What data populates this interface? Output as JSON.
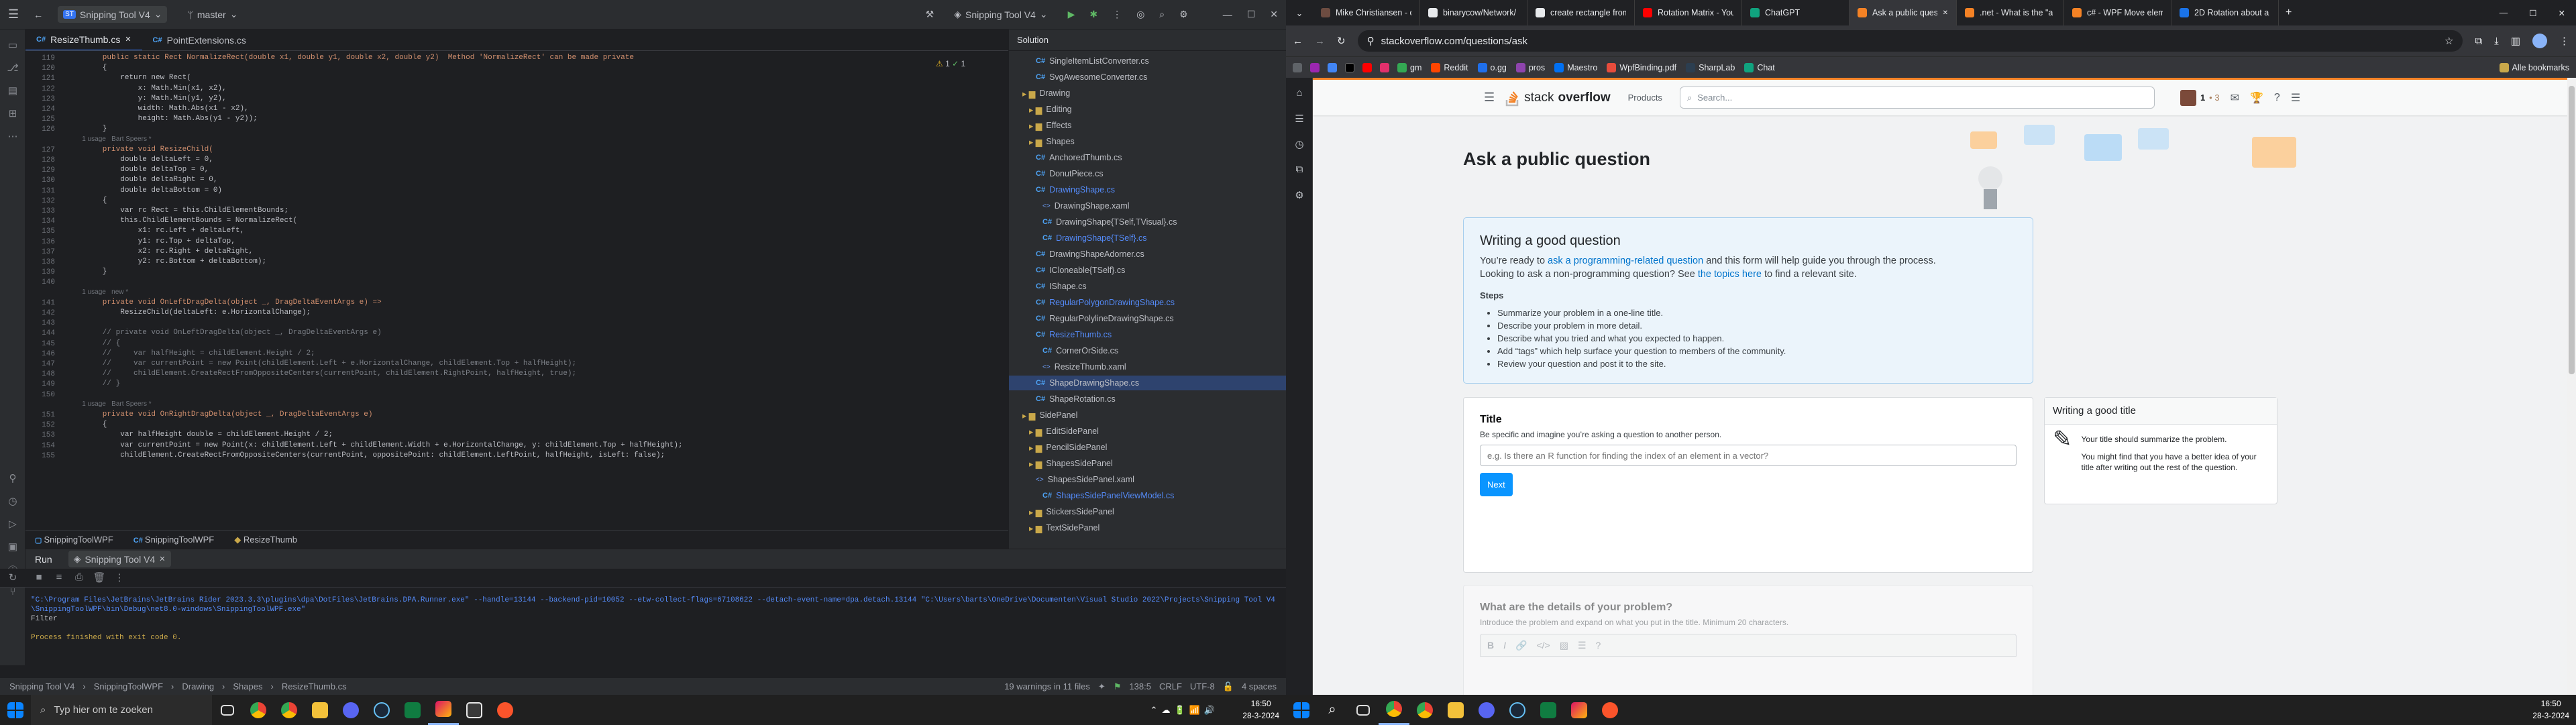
{
  "ide": {
    "project": "Snipping Tool V4",
    "branch": "master",
    "run_config": "Snipping Tool V4",
    "tabs": [
      {
        "label": "ResizeThumb.cs",
        "active": true
      },
      {
        "label": "PointExtensions.cs",
        "active": false
      }
    ],
    "inspections": {
      "warnings": "1",
      "checks": "1"
    },
    "code_lines": [
      {
        "n": "119",
        "text": "        public static Rect NormalizeRect(double x1, double y1, double x2, double y2)  Method 'NormalizeRect' can be made private",
        "cls": "kw"
      },
      {
        "n": "120",
        "text": "        {",
        "cls": ""
      },
      {
        "n": "121",
        "text": "            return new Rect(",
        "cls": ""
      },
      {
        "n": "122",
        "text": "                x: Math.Min(x1, x2),",
        "cls": ""
      },
      {
        "n": "123",
        "text": "                y: Math.Min(y1, y2),",
        "cls": ""
      },
      {
        "n": "124",
        "text": "                width: Math.Abs(x1 - x2),",
        "cls": ""
      },
      {
        "n": "125",
        "text": "                height: Math.Abs(y1 - y2));",
        "cls": ""
      },
      {
        "n": "126",
        "text": "        }",
        "cls": ""
      },
      {
        "n": "",
        "text": "        1 usage   Bart Speers *",
        "cls": "hint"
      },
      {
        "n": "127",
        "text": "        private void ResizeChild(",
        "cls": "kw"
      },
      {
        "n": "128",
        "text": "            double deltaLeft = 0,",
        "cls": ""
      },
      {
        "n": "129",
        "text": "            double deltaTop = 0,",
        "cls": ""
      },
      {
        "n": "130",
        "text": "            double deltaRight = 0,",
        "cls": ""
      },
      {
        "n": "131",
        "text": "            double deltaBottom = 0)",
        "cls": ""
      },
      {
        "n": "132",
        "text": "        {",
        "cls": ""
      },
      {
        "n": "133",
        "text": "            var rc Rect = this.ChildElementBounds;",
        "cls": ""
      },
      {
        "n": "134",
        "text": "            this.ChildElementBounds = NormalizeRect(",
        "cls": ""
      },
      {
        "n": "135",
        "text": "                x1: rc.Left + deltaLeft,",
        "cls": ""
      },
      {
        "n": "136",
        "text": "                y1: rc.Top + deltaTop,",
        "cls": ""
      },
      {
        "n": "137",
        "text": "                x2: rc.Right + deltaRight,",
        "cls": ""
      },
      {
        "n": "138",
        "text": "                y2: rc.Bottom + deltaBottom);",
        "cls": ""
      },
      {
        "n": "139",
        "text": "        }",
        "cls": ""
      },
      {
        "n": "140",
        "text": "",
        "cls": "cur"
      },
      {
        "n": "",
        "text": "        1 usage   new *",
        "cls": "hint"
      },
      {
        "n": "141",
        "text": "        private void OnLeftDragDelta(object _, DragDeltaEventArgs e) =>",
        "cls": "kw"
      },
      {
        "n": "142",
        "text": "            ResizeChild(deltaLeft: e.HorizontalChange);",
        "cls": ""
      },
      {
        "n": "143",
        "text": "",
        "cls": ""
      },
      {
        "n": "144",
        "text": "        // private void OnLeftDragDelta(object _, DragDeltaEventArgs e)",
        "cls": "cm"
      },
      {
        "n": "145",
        "text": "        // {",
        "cls": "cm"
      },
      {
        "n": "146",
        "text": "        //     var halfHeight = childElement.Height / 2;",
        "cls": "cm"
      },
      {
        "n": "147",
        "text": "        //     var currentPoint = new Point(childElement.Left + e.HorizontalChange, childElement.Top + halfHeight);",
        "cls": "cm"
      },
      {
        "n": "148",
        "text": "        //     childElement.CreateRectFromOppositeCenters(currentPoint, childElement.RightPoint, halfHeight, true);",
        "cls": "cm"
      },
      {
        "n": "149",
        "text": "        // }",
        "cls": "cm"
      },
      {
        "n": "150",
        "text": "",
        "cls": ""
      },
      {
        "n": "",
        "text": "        1 usage   Bart Speers *",
        "cls": "hint"
      },
      {
        "n": "151",
        "text": "        private void OnRightDragDelta(object _, DragDeltaEventArgs e)",
        "cls": "kw"
      },
      {
        "n": "152",
        "text": "        {",
        "cls": ""
      },
      {
        "n": "153",
        "text": "            var halfHeight double = childElement.Height / 2;",
        "cls": ""
      },
      {
        "n": "154",
        "text": "            var currentPoint = new Point(x: childElement.Left + childElement.Width + e.HorizontalChange, y: childElement.Top + halfHeight);",
        "cls": ""
      },
      {
        "n": "155",
        "text": "            childElement.CreateRectFromOppositeCenters(currentPoint, oppositePoint: childElement.LeftPoint, halfHeight, isLeft: false);",
        "cls": ""
      }
    ],
    "breadcrumbs": [
      "SnippingToolWPF",
      "SnippingToolWPF",
      "ResizeThumb"
    ],
    "solution_title": "Solution",
    "tree": [
      {
        "label": "SingleItemListConverter.cs",
        "kind": "cs",
        "indent": 4
      },
      {
        "label": "SvgAwesomeConverter.cs",
        "kind": "cs",
        "indent": 4
      },
      {
        "label": "Drawing",
        "kind": "folder",
        "indent": 2
      },
      {
        "label": "Editing",
        "kind": "folder",
        "indent": 3
      },
      {
        "label": "Effects",
        "kind": "folder",
        "indent": 3
      },
      {
        "label": "Shapes",
        "kind": "folder",
        "indent": 3
      },
      {
        "label": "AnchoredThumb.cs",
        "kind": "cs",
        "indent": 4
      },
      {
        "label": "DonutPiece.cs",
        "kind": "cs",
        "indent": 4
      },
      {
        "label": "DrawingShape.cs",
        "kind": "cs-blue",
        "indent": 4
      },
      {
        "label": "DrawingShape.xaml",
        "kind": "xaml",
        "indent": 5
      },
      {
        "label": "DrawingShape{TSelf,TVisual}.cs",
        "kind": "cs",
        "indent": 5
      },
      {
        "label": "DrawingShape{TSelf}.cs",
        "kind": "cs-blue",
        "indent": 5
      },
      {
        "label": "DrawingShapeAdorner.cs",
        "kind": "cs",
        "indent": 4
      },
      {
        "label": "ICloneable{TSelf}.cs",
        "kind": "cs",
        "indent": 4
      },
      {
        "label": "IShape.cs",
        "kind": "cs",
        "indent": 4
      },
      {
        "label": "RegularPolygonDrawingShape.cs",
        "kind": "cs-blue",
        "indent": 4
      },
      {
        "label": "RegularPolylineDrawingShape.cs",
        "kind": "cs",
        "indent": 4
      },
      {
        "label": "ResizeThumb.cs",
        "kind": "cs-blue",
        "indent": 4
      },
      {
        "label": "CornerOrSide.cs",
        "kind": "cs",
        "indent": 5
      },
      {
        "label": "ResizeThumb.xaml",
        "kind": "xaml",
        "indent": 5
      },
      {
        "label": "ShapeDrawingShape.cs",
        "kind": "sel",
        "indent": 4
      },
      {
        "label": "ShapeRotation.cs",
        "kind": "cs",
        "indent": 4
      },
      {
        "label": "SidePanel",
        "kind": "folder",
        "indent": 2
      },
      {
        "label": "EditSidePanel",
        "kind": "folder",
        "indent": 3
      },
      {
        "label": "PencilSidePanel",
        "kind": "folder",
        "indent": 3
      },
      {
        "label": "ShapesSidePanel",
        "kind": "folder",
        "indent": 3
      },
      {
        "label": "ShapesSidePanel.xaml",
        "kind": "xaml",
        "indent": 4
      },
      {
        "label": "ShapesSidePanelViewModel.cs",
        "kind": "cs-blue",
        "indent": 5
      },
      {
        "label": "StickersSidePanel",
        "kind": "folder",
        "indent": 3
      },
      {
        "label": "TextSidePanel",
        "kind": "folder",
        "indent": 3
      }
    ],
    "run": {
      "tab_run": "Run",
      "tab_config": "Snipping Tool V4",
      "command": "\"C:\\Program Files\\JetBrains\\JetBrains Rider 2023.3.3\\plugins\\dpa\\DotFiles\\JetBrains.DPA.Runner.exe\" --handle=13144 --backend-pid=10052 --etw-collect-flags=67108622 --detach-event-name=dpa.detach.13144 \"C:\\Users\\barts\\OneDrive\\Documenten\\Visual Studio 2022\\Projects\\Snipping Tool V4\\SnippingToolWPF\\bin\\Debug\\net8.0-windows\\SnippingToolWPF.exe\"",
      "line2": "Filter",
      "exit": "Process finished with exit code 0."
    },
    "status": {
      "path": [
        "Snipping Tool V4",
        "SnippingToolWPF",
        "Drawing",
        "Shapes",
        "ResizeThumb.cs"
      ],
      "warnings": "19 warnings in 11 files",
      "pos": "138:5",
      "eol": "CRLF",
      "enc": "UTF-8",
      "indent": "4 spaces"
    }
  },
  "browser": {
    "tabs": [
      {
        "label": "Mike Christiansen - c",
        "color": "#6d4c41"
      },
      {
        "label": "binarycow/Network/",
        "color": "#e8eaed"
      },
      {
        "label": "create rectangle from",
        "color": "#e8eaed"
      },
      {
        "label": "Rotation Matrix - You",
        "color": "#ff0000"
      },
      {
        "label": "ChatGPT",
        "color": "#10a37f"
      },
      {
        "label": "Ask a public question",
        "color": "#f48225",
        "active": true
      },
      {
        "label": ".net - What is the \"a",
        "color": "#f48225"
      },
      {
        "label": "c# - WPF Move elem",
        "color": "#f48225"
      },
      {
        "label": "2D Rotation about a p",
        "color": "#1a73e8"
      }
    ],
    "url": "stackoverflow.com/questions/ask",
    "bookmarks": [
      "gm",
      "Reddit",
      "o.gg",
      "pros",
      "Maestro",
      "WpfBinding.pdf",
      "SharpLab",
      "Chat"
    ],
    "all_bookmarks": "Alle bookmarks"
  },
  "so": {
    "logo_a": "stack",
    "logo_b": "overflow",
    "products": "Products",
    "search_placeholder": "Search...",
    "rep": "1",
    "badge": "• 3",
    "page_title": "Ask a public question",
    "good_title": "Writing a good question",
    "good_p1a": "You’re ready to ",
    "good_link1": "ask a programming-related question",
    "good_p1b": " and this form will help guide you through the process.",
    "good_p2a": "Looking to ask a non-programming question? See ",
    "good_link2": "the topics here",
    "good_p2b": " to find a relevant site.",
    "steps_title": "Steps",
    "steps": [
      "Summarize your problem in a one-line title.",
      "Describe your problem in more detail.",
      "Describe what you tried and what you expected to happen.",
      "Add “tags” which help surface your question to members of the community.",
      "Review your question and post it to the site."
    ],
    "title_label": "Title",
    "title_help": "Be specific and imagine you’re asking a question to another person.",
    "title_placeholder": "e.g. Is there an R function for finding the index of an element in a vector?",
    "next": "Next",
    "tip_title": "Writing a good title",
    "tip_1": "Your title should summarize the problem.",
    "tip_2": "You might find that you have a better idea of your title after writing out the rest of the question.",
    "details_title": "What are the details of your problem?",
    "details_help": "Introduce the problem and expand on what you put in the title. Minimum 20 characters."
  },
  "taskbar": {
    "search_placeholder": "Typ hier om te zoeken",
    "time1": "16:50",
    "date1": "28-3-2024",
    "time2": "16:50",
    "date2": "28-3-2024"
  },
  "colors": {
    "accent": "#3574f0",
    "so_orange": "#f48225",
    "so_blue": "#0a95ff"
  }
}
